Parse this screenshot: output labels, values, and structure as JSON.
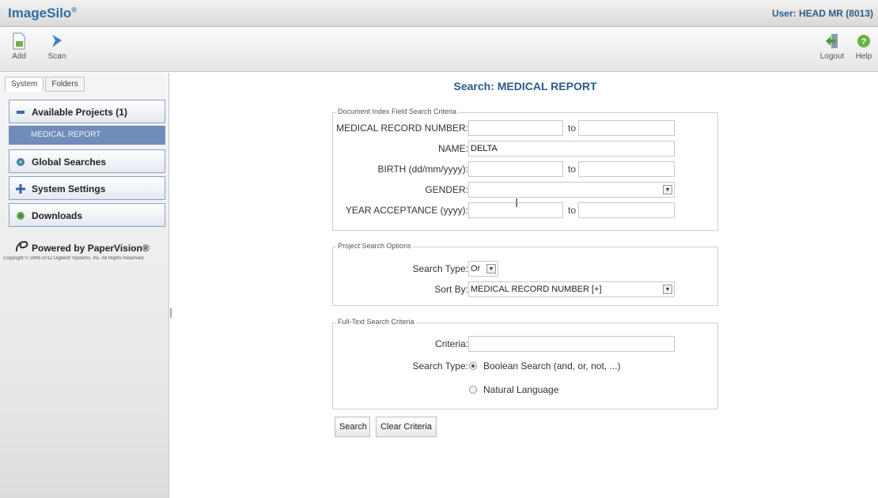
{
  "app": {
    "brand": "ImageSilo",
    "reg": "®",
    "user": "User: HEAD MR (8013)"
  },
  "toolbar": {
    "add": "Add",
    "scan": "Scan",
    "logout": "Logout",
    "help": "Help"
  },
  "sidebar": {
    "tabs": [
      "System",
      "Folders"
    ],
    "available_projects": "Available Projects (1)",
    "project_item": "MEDICAL REPORT",
    "global_searches": "Global Searches",
    "system_settings": "System Settings",
    "downloads": "Downloads",
    "powered_by": "Powered by PaperVision®",
    "copyright": "Copyright © 1998-2012 Digitech Systems, Inc. All Rights Reserved."
  },
  "main": {
    "title": "Search: MEDICAL REPORT",
    "index_group": {
      "legend": "Document Index Field Search Criteria",
      "medical_record_label": "MEDICAL RECORD NUMBER:",
      "name_label": "NAME:",
      "name_value": "DELTA",
      "birth_label": "BIRTH (dd/mm/yyyy):",
      "gender_label": "GENDER:",
      "gender_value": "",
      "year_label": "YEAR ACCEPTANCE (yyyy):",
      "to": "to"
    },
    "options_group": {
      "legend": "Project Search Options",
      "search_type_label": "Search Type:",
      "search_type_value": "Or",
      "sort_by_label": "Sort By:",
      "sort_by_value": "MEDICAL RECORD NUMBER [+]"
    },
    "fulltext_group": {
      "legend": "Full-Text Search Criteria",
      "criteria_label": "Criteria:",
      "search_type_label": "Search Type:",
      "boolean_label": "Boolean Search (and, or, not, ...)",
      "natural_label": "Natural Language"
    },
    "buttons": {
      "search": "Search",
      "clear": "Clear Criteria"
    }
  },
  "colors": {
    "brand": "#2e6ea8",
    "project_highlight": "#6f8cbb",
    "nav_border": "#8aa1c4"
  }
}
